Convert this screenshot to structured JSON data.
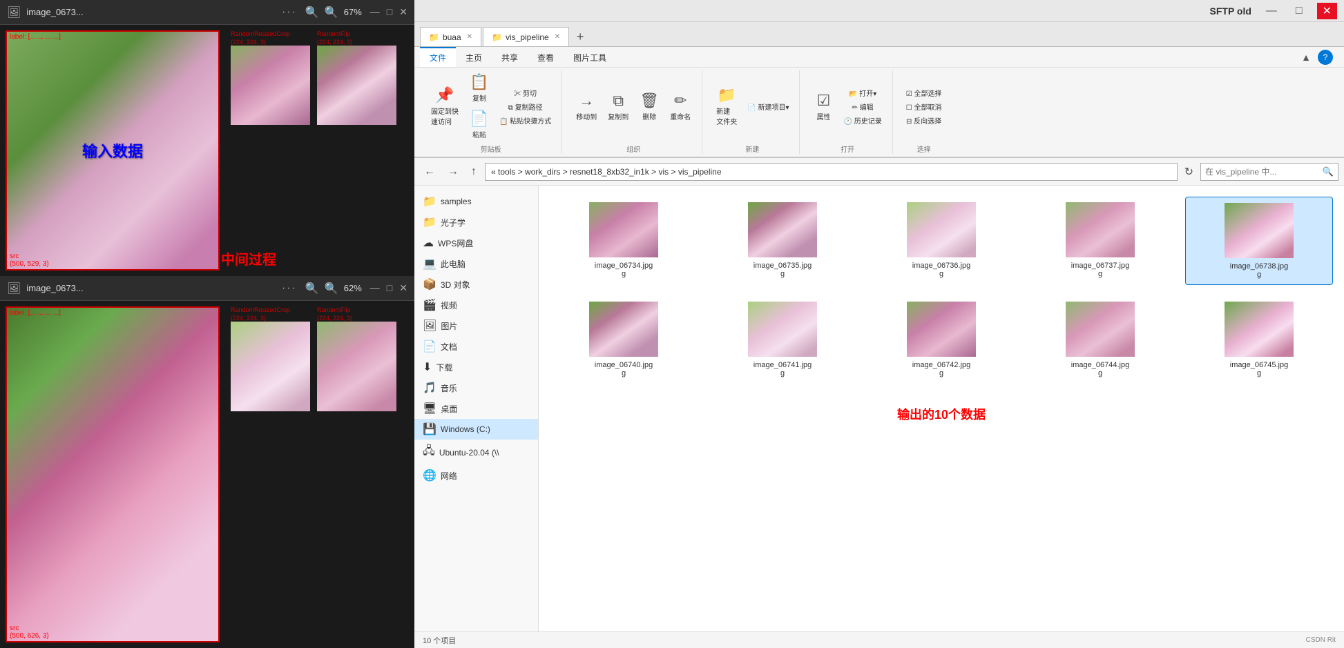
{
  "leftPanel": {
    "topViewer": {
      "title": "image_0673...",
      "zoomLevel": "67%",
      "labelText": "label: [... ... ... ...]",
      "srcText": "src\n(500, 529, 3)",
      "inputLabel": "输入数据",
      "processLabel": "中间过程",
      "thumbs": [
        {
          "label": "RandomResizedCrop",
          "sublabel": "(224, 224, 3)"
        },
        {
          "label": "RandomFlip",
          "sublabel": "(224, 224, 3)"
        }
      ]
    },
    "bottomViewer": {
      "title": "image_0673...",
      "zoomLevel": "62%",
      "labelText": "label: [... ... ... ...]",
      "srcText": "src\n(500, 626, 3)",
      "thumbs": [
        {
          "label": "RandomResizedCrop",
          "sublabel": "(224, 224, 3)"
        },
        {
          "label": "RandomFlip",
          "sublabel": "(224, 224, 3)"
        }
      ]
    }
  },
  "rightPanel": {
    "titlebar": {
      "sftp": "SFTP",
      "old": "old",
      "minBtn": "—",
      "maxBtn": "□",
      "closeBtn": "✕"
    },
    "tabs": [
      {
        "label": "buaa",
        "closable": true
      },
      {
        "label": "vis_pipeline",
        "closable": true
      }
    ],
    "addTab": "+",
    "ribbon": {
      "tabs": [
        "文件",
        "主页",
        "共享",
        "查看",
        "图片工具"
      ],
      "activeTab": "文件",
      "groups": {
        "clipboard": {
          "label": "剪贴板",
          "buttons": [
            {
              "icon": "📌",
              "label": "固定到快\n速访问"
            },
            {
              "icon": "📋",
              "label": "复制"
            },
            {
              "icon": "📌",
              "label": "粘贴"
            }
          ],
          "smallButtons": [
            {
              "label": "✂ 剪切"
            },
            {
              "label": "⧉ 复制路径"
            },
            {
              "label": "📋 粘贴快捷方式"
            }
          ]
        },
        "organize": {
          "label": "组织",
          "buttons": [
            {
              "icon": "→",
              "label": "移动到"
            },
            {
              "icon": "⧉",
              "label": "复制到"
            },
            {
              "icon": "🗑",
              "label": "删除"
            },
            {
              "icon": "✏",
              "label": "重命名"
            }
          ]
        },
        "newGroup": {
          "label": "新建",
          "buttons": [
            {
              "icon": "📁",
              "label": "新建\n文件夹"
            }
          ],
          "smallButtons": [
            {
              "label": "📄 新建项目▾"
            }
          ]
        },
        "open": {
          "label": "打开",
          "buttons": [
            {
              "icon": "☑",
              "label": "属性"
            }
          ],
          "smallButtons": [
            {
              "label": "📂 打开▾"
            },
            {
              "label": "✏ 编辑"
            },
            {
              "label": "🕐 历史记录"
            }
          ]
        },
        "select": {
          "label": "选择",
          "smallButtons": [
            {
              "label": "☑ 全部选择"
            },
            {
              "label": "☐ 全部取消"
            },
            {
              "label": "⊟ 反向选择"
            }
          ]
        }
      }
    },
    "addressBar": {
      "path": "« tools > work_dirs > resnet18_8xb32_in1k > vis > vis_pipeline",
      "searchPlaceholder": "在 vis_pipeline 中..."
    },
    "sidebar": {
      "items": [
        {
          "icon": "📁",
          "label": "samples"
        },
        {
          "icon": "📁",
          "label": "光子学"
        },
        {
          "icon": "☁",
          "label": "WPS网盘"
        },
        {
          "icon": "💻",
          "label": "此电脑"
        },
        {
          "icon": "📦",
          "label": "3D 对象"
        },
        {
          "icon": "🎬",
          "label": "视频"
        },
        {
          "icon": "🖼",
          "label": "图片"
        },
        {
          "icon": "📄",
          "label": "文档"
        },
        {
          "icon": "⬇",
          "label": "下载"
        },
        {
          "icon": "🎵",
          "label": "音乐"
        },
        {
          "icon": "🖥",
          "label": "桌面"
        },
        {
          "icon": "💾",
          "label": "Windows (C:)"
        },
        {
          "icon": "🖧",
          "label": "Ubuntu-20.04 (\\\\"
        },
        {
          "icon": "🌐",
          "label": "网络"
        }
      ]
    },
    "files": [
      {
        "name": "image_06734.jpg\ng",
        "thumb": "1"
      },
      {
        "name": "image_06735.jpg\ng",
        "thumb": "2"
      },
      {
        "name": "image_06736.jpg\ng",
        "thumb": "3"
      },
      {
        "name": "image_06737.jpg\ng",
        "thumb": "4"
      },
      {
        "name": "image_06738.jpg\ng",
        "thumb": "5",
        "selected": true
      },
      {
        "name": "image_06740.jpg\ng",
        "thumb": "2"
      },
      {
        "name": "image_06741.jpg\ng",
        "thumb": "3"
      },
      {
        "name": "image_06742.jpg\ng",
        "thumb": "1"
      },
      {
        "name": "image_06744.jpg\ng",
        "thumb": "4"
      },
      {
        "name": "image_06745.jpg\ng",
        "thumb": "5"
      }
    ],
    "outputLabel": "输出的10个数据",
    "statusBar": "10 个项目"
  }
}
